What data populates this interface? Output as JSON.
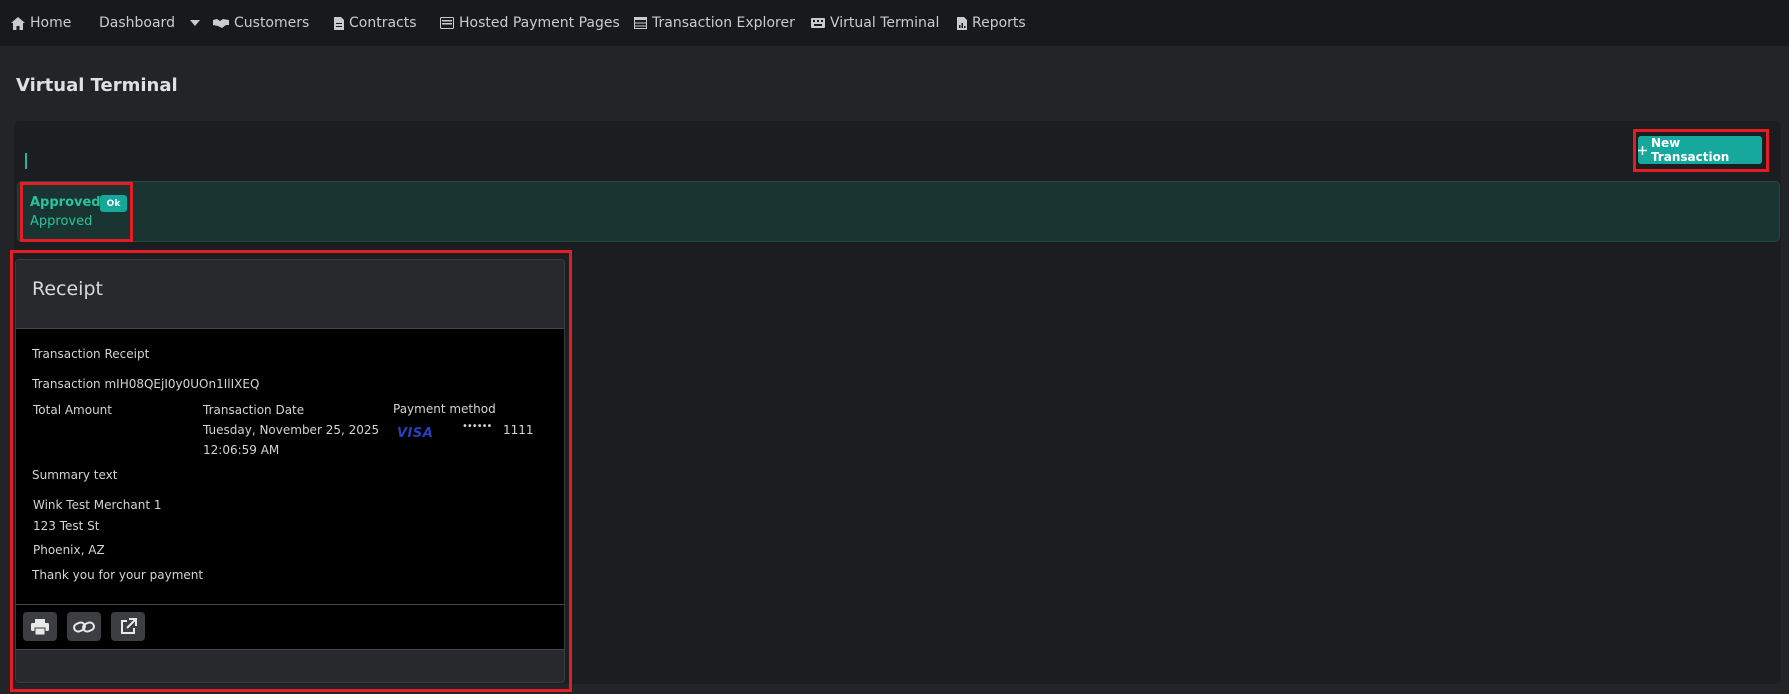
{
  "nav": {
    "home": "Home",
    "dashboard": "Dashboard",
    "customers": "Customers",
    "contracts": "Contracts",
    "hosted_payment_pages": "Hosted Payment Pages",
    "transaction_explorer": "Transaction Explorer",
    "virtual_terminal": "Virtual Terminal",
    "reports": "Reports"
  },
  "page": {
    "title": "Virtual Terminal"
  },
  "toolbar": {
    "new_transaction": "New Transaction"
  },
  "alert": {
    "title": "Approved",
    "badge": "Ok",
    "message": "Approved"
  },
  "receipt": {
    "header": "Receipt",
    "heading": "Transaction Receipt",
    "transaction_line": "Transaction mIH08QEjI0y0UOn1IlIXEQ",
    "total_amount_label": "Total Amount",
    "transaction_date_label": "Transaction Date",
    "transaction_date_line1": "Tuesday, November 25, 2025",
    "transaction_date_line2": "12:06:59 AM",
    "payment_method_label": "Payment method",
    "card_brand": "VISA",
    "card_mask": "••••••",
    "card_last4": "1111",
    "summary_label": "Summary text",
    "merchant_name": "Wink Test Merchant 1",
    "address_line1": "123 Test St",
    "address_line2": "Phoenix, AZ",
    "thank_you": "Thank you for your payment"
  },
  "icons": {
    "home": "home-icon",
    "dashboard_caret": "chevron-down-icon",
    "customers": "handshake-icon",
    "contracts": "document-icon",
    "hosted_payment_pages": "pages-icon",
    "transaction_explorer": "table-icon",
    "virtual_terminal": "keyboard-icon",
    "reports": "report-icon",
    "new_transaction": "plus-icon",
    "print": "print-icon",
    "link": "link-icon",
    "external": "external-link-icon"
  },
  "colors": {
    "accent": "#16a89c",
    "success_text": "#27c59a",
    "highlight_border": "#e21d23",
    "visa_blue": "#2a3fb8"
  }
}
